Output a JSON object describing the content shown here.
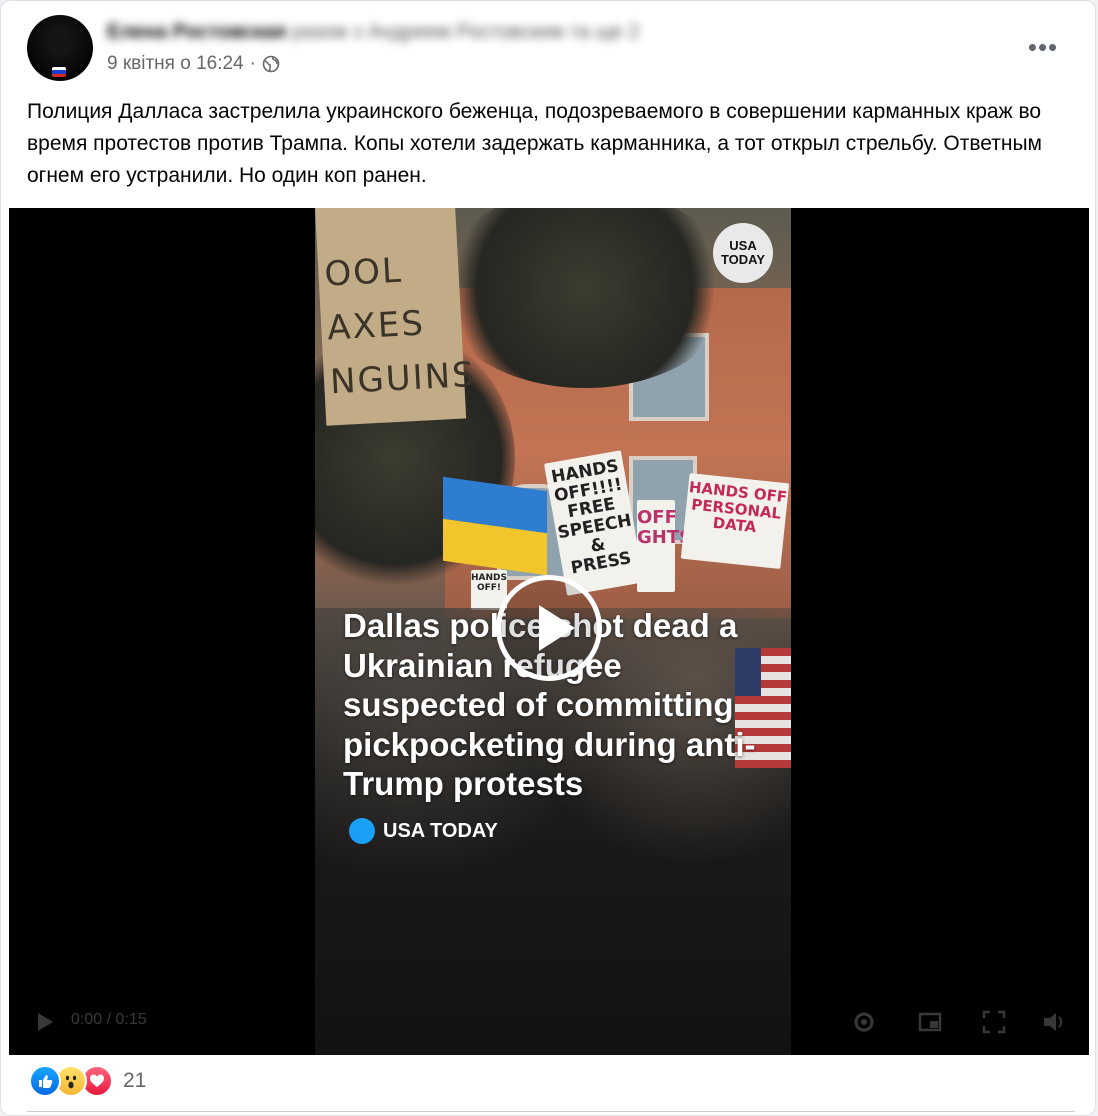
{
  "post": {
    "author": "Елена Ростовская",
    "author_suffix": "разом з Андреем Ростовским та ще 2",
    "date": "9 квітня о 16:24",
    "separator": "·",
    "privacy_icon": "globe-icon",
    "more_icon": "more-horizontal-icon",
    "text": "Полиция Далласа застрелила украинского беженца, подозреваемого в совершении карманных краж во время протестов против Трампа. Копы хотели задержать карманника, а тот открыл стрельбу. Ответным огнем его устранили. Но один коп ранен."
  },
  "video": {
    "watermark": "USA\nTODAY",
    "headline": "Dallas police shot dead a Ukrainian refugee suspected of committing pickpocketing during anti-Trump protests",
    "brand": "USA TODAY",
    "brand_color": "#1a9ff7",
    "play_icon": "play-icon",
    "signs": {
      "cardboard": "OOL\nAXES\nNGUINS",
      "hands_off_free": "HANDS\nOFF!!!!\nFREE SPEECH\n& PRESS",
      "rights": "OFF\nGHTS",
      "personal_data": "HANDS OFF\nPERSONAL\nDATA",
      "small": "HANDS\nOFF!"
    },
    "controls": {
      "time": "0:00 / 0:15",
      "icons": [
        "play-icon",
        "settings-icon",
        "fullscreen-icon",
        "volume-icon"
      ]
    }
  },
  "reactions": {
    "icons": [
      "like-icon",
      "wow-icon",
      "love-icon"
    ],
    "count": "21"
  },
  "colors": {
    "like": "#0668e1",
    "love": "#e61739",
    "wow": "#f6b533",
    "secondary_text": "#65676b"
  }
}
